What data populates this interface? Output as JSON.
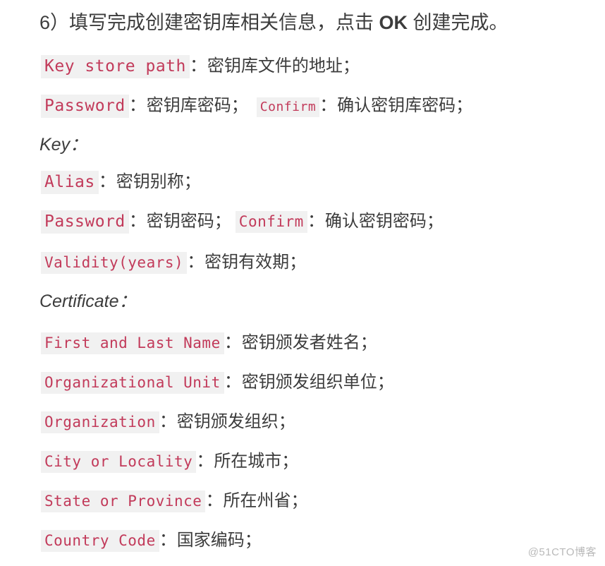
{
  "document": {
    "heading": {
      "prefix": "6）填写完成创建密钥库相关信息，点击 ",
      "emphasis": "OK",
      "suffix": " 创建完成。"
    },
    "colors": {
      "code_text": "#c23a5a",
      "code_background": "#f1f1f1",
      "body_text": "#3c3c3c",
      "page_background": "#ffffff",
      "watermark_text": "#b9b9b9"
    },
    "lines": [
      {
        "id": "key-store-path",
        "parts": [
          {
            "type": "code",
            "text": "Key store path",
            "size": "lg"
          },
          {
            "type": "text",
            "text": "：",
            "size": "lg"
          },
          {
            "type": "text",
            "text": "密钥库文件的地址；",
            "size": "lg"
          }
        ]
      },
      {
        "id": "keystore-password",
        "parts": [
          {
            "type": "code",
            "text": "Password",
            "size": "lg"
          },
          {
            "type": "text",
            "text": "：",
            "size": "lg"
          },
          {
            "type": "text",
            "text": "密钥库密码；",
            "size": "lg"
          },
          {
            "type": "gap",
            "text": "",
            "size": "md"
          },
          {
            "type": "code",
            "text": "Confirm",
            "size": "sm"
          },
          {
            "type": "text",
            "text": "：",
            "size": "lg"
          },
          {
            "type": "text",
            "text": "确认密钥库密码；",
            "size": "lg"
          }
        ]
      },
      {
        "id": "section-key",
        "section": true,
        "text": "Key："
      },
      {
        "id": "key-alias",
        "parts": [
          {
            "type": "code",
            "text": "Alias",
            "size": "lg"
          },
          {
            "type": "text",
            "text": "：",
            "size": "lg"
          },
          {
            "type": "text",
            "text": "密钥别称；",
            "size": "lg"
          }
        ]
      },
      {
        "id": "key-password",
        "parts": [
          {
            "type": "code",
            "text": "Password",
            "size": "lg"
          },
          {
            "type": "text",
            "text": "：",
            "size": "lg"
          },
          {
            "type": "text",
            "text": "密钥密码；",
            "size": "lg"
          },
          {
            "type": "gap",
            "text": "",
            "size": "sm"
          },
          {
            "type": "code",
            "text": "Confirm",
            "size": "md"
          },
          {
            "type": "text",
            "text": "：",
            "size": "lg"
          },
          {
            "type": "text",
            "text": "确认密钥密码；",
            "size": "lg"
          }
        ]
      },
      {
        "id": "key-validity",
        "parts": [
          {
            "type": "code",
            "text": "Validity(years)",
            "size": "md"
          },
          {
            "type": "text",
            "text": "：",
            "size": "lg"
          },
          {
            "type": "text",
            "text": "密钥有效期；",
            "size": "lg"
          }
        ]
      },
      {
        "id": "section-certificate",
        "section": true,
        "text": "Certificate："
      },
      {
        "id": "cert-first-and-last-name",
        "parts": [
          {
            "type": "code",
            "text": "First and Last Name",
            "size": "md"
          },
          {
            "type": "text",
            "text": "：",
            "size": "lg"
          },
          {
            "type": "text",
            "text": "密钥颁发者姓名；",
            "size": "lg"
          }
        ]
      },
      {
        "id": "cert-organizational-unit",
        "parts": [
          {
            "type": "code",
            "text": "Organizational Unit",
            "size": "md"
          },
          {
            "type": "text",
            "text": "：",
            "size": "lg"
          },
          {
            "type": "text",
            "text": "密钥颁发组织单位；",
            "size": "lg"
          }
        ]
      },
      {
        "id": "cert-organization",
        "parts": [
          {
            "type": "code",
            "text": "Organization",
            "size": "md"
          },
          {
            "type": "text",
            "text": "：",
            "size": "lg"
          },
          {
            "type": "text",
            "text": "密钥颁发组织；",
            "size": "lg"
          }
        ]
      },
      {
        "id": "cert-city-or-locality",
        "parts": [
          {
            "type": "code",
            "text": "City or Locality",
            "size": "md"
          },
          {
            "type": "text",
            "text": "：",
            "size": "lg"
          },
          {
            "type": "text",
            "text": "所在城市；",
            "size": "lg"
          }
        ]
      },
      {
        "id": "cert-state-or-province",
        "parts": [
          {
            "type": "code",
            "text": "State or Province",
            "size": "md"
          },
          {
            "type": "text",
            "text": "：",
            "size": "lg"
          },
          {
            "type": "text",
            "text": "所在州省；",
            "size": "lg"
          }
        ]
      },
      {
        "id": "cert-country-code",
        "parts": [
          {
            "type": "code",
            "text": "Country Code",
            "size": "md"
          },
          {
            "type": "text",
            "text": "：",
            "size": "lg"
          },
          {
            "type": "text",
            "text": "国家编码；",
            "size": "lg"
          }
        ]
      }
    ],
    "watermark": "@51CTO博客"
  }
}
